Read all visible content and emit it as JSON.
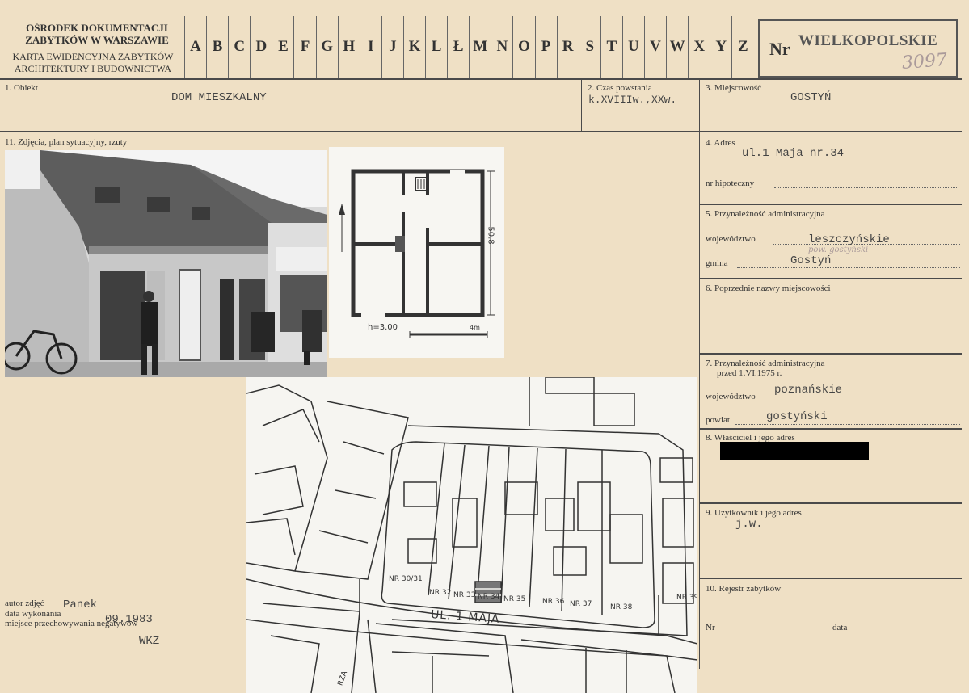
{
  "header": {
    "org_line1": "OŚRODEK DOKUMENTACJI",
    "org_line2": "ZABYTKÓW W WARSZAWIE",
    "form_line1": "KARTA EWIDENCYJNA ZABYTKÓW",
    "form_line2": "ARCHITEKTURY I BUDOWNICTWA",
    "letters": [
      "A",
      "B",
      "C",
      "D",
      "E",
      "F",
      "G",
      "H",
      "I",
      "J",
      "K",
      "L",
      "Ł",
      "M",
      "N",
      "O",
      "P",
      "R",
      "S",
      "T",
      "U",
      "V",
      "W",
      "X",
      "Y",
      "Z"
    ],
    "nr_label": "Nr",
    "region": "WIELKOPOLSKIE",
    "number_handwritten": "3097"
  },
  "fields": {
    "obiekt_label": "1. Obiekt",
    "obiekt_value": "DOM MIESZKALNY",
    "czas_label": "2. Czas powstania",
    "czas_value": "k.XVIIIw.,XXw.",
    "miejscowosc_label": "3. Miejscowość",
    "miejscowosc_value": "GOSTYŃ",
    "zdjecia_label": "11. Zdjęcia, plan sytuacyjny, rzuty",
    "adres_label": "4. Adres",
    "adres_value": "ul.1 Maja nr.34",
    "hipoteczny_label": "nr hipoteczny",
    "przynaleznosc_label": "5. Przynależność administracyjna",
    "wojewodztwo_label": "województwo",
    "wojewodztwo_value": "leszczyńskie",
    "gmina_label": "gmina",
    "gmina_value": "Gostyń",
    "gmina_note": "pow. gostyński",
    "poprzednie_label": "6. Poprzednie nazwy miejscowości",
    "przynaleznosc_przed_label1": "7. Przynależność administracyjna",
    "przynaleznosc_przed_label2": "przed 1.VI.1975 r.",
    "wojewodztwo_przed_label": "województwo",
    "wojewodztwo_przed_value": "poznańskie",
    "powiat_label": "powiat",
    "powiat_value": "gostyński",
    "wlasciciel_label": "8. Właściciel i jego adres",
    "uzytkownik_label": "9. Użytkownik i jego adres",
    "uzytkownik_value": "j.w.",
    "rejestr_label": "10. Rejestr zabytków",
    "nr_label": "Nr",
    "data_label": "data"
  },
  "footer": {
    "autor_label": "autor zdjęć",
    "autor_value": "Panek",
    "data_label": "data wykonania",
    "data_value": "09.1983",
    "miejsce_label": "miejsce przechowywania negatywów",
    "miejsce_value": "WKZ"
  },
  "plan": {
    "dimension_v": "50.8",
    "height_note": "h=3.00",
    "scale_label": "4m"
  },
  "map": {
    "street": "UL. 1 MAJA",
    "lots": [
      "NR 30/31",
      "NR 32",
      "NR 33",
      "NR 34",
      "NR 35",
      "NR 36",
      "NR 37",
      "NR 38",
      "NR 39"
    ],
    "bottom_label": "RZA"
  },
  "colors": {
    "paper": "#efe0c5",
    "ink": "#444444",
    "pencil": "#aa9a9a",
    "redaction": "#000000"
  }
}
